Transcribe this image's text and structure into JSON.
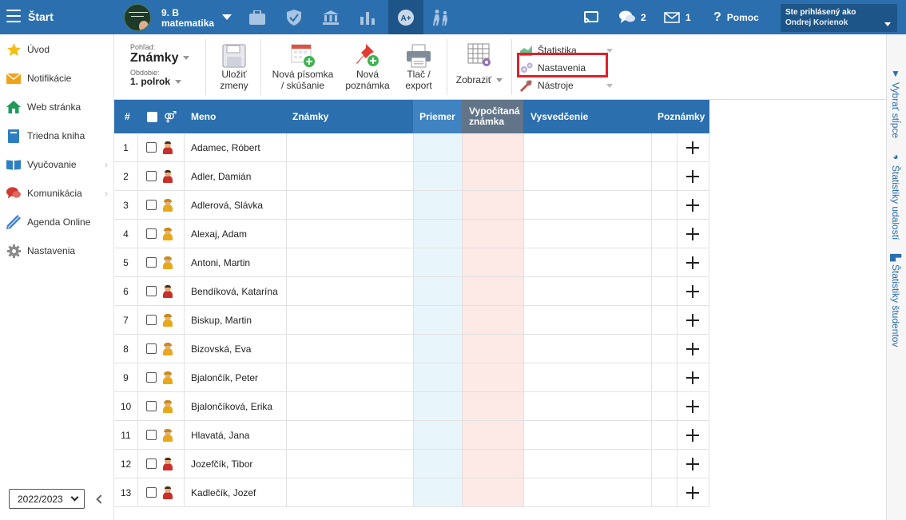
{
  "header": {
    "menu_label": "Štart",
    "class": {
      "line1": "9. B",
      "line2": "matematika"
    },
    "messages_count": "2",
    "mail_count": "1",
    "help_label": "Pomoc",
    "user": {
      "label": "Ste prihlásený ako",
      "name": "Ondrej Korienok"
    }
  },
  "sidebar": {
    "items": [
      {
        "label": "Úvod",
        "icon": "star-icon"
      },
      {
        "label": "Notifikácie",
        "icon": "envelope-icon"
      },
      {
        "label": "Web stránka",
        "icon": "home-icon"
      },
      {
        "label": "Triedna kniha",
        "icon": "book-icon"
      },
      {
        "label": "Vyučovanie",
        "icon": "open-book-icon"
      },
      {
        "label": "Komunikácia",
        "icon": "chat-icon"
      },
      {
        "label": "Agenda Online",
        "icon": "pen-icon"
      },
      {
        "label": "Nastavenia",
        "icon": "gear-icon"
      }
    ],
    "school_year": "2022/2023"
  },
  "toolbar": {
    "view_label": "Pohľad:",
    "view_value": "Známky",
    "period_label": "Obdobie:",
    "period_value": "1. polrok",
    "save_line1": "Uložiť",
    "save_line2": "zmeny",
    "new_test_line1": "Nová písomka",
    "new_test_line2": "/ skúšanie",
    "new_note_line1": "Nová",
    "new_note_line2": "poznámka",
    "print_line1": "Tlač /",
    "print_line2": "export",
    "show_label": "Zobraziť",
    "menu_statistics": "Štatistika",
    "menu_settings": "Nastavenia",
    "menu_tools": "Nástroje"
  },
  "right_tabs": {
    "columns": "Vybrať stĺpce",
    "event_stats": "Štatistiky udalostí",
    "student_stats": "Štatistiky študentov"
  },
  "table": {
    "headers": {
      "num": "#",
      "gender_symbol": "⚤",
      "name": "Meno",
      "grades": "Známky",
      "average": "Priemer",
      "computed_line1": "Vypočítaná",
      "computed_line2": "známka",
      "report": "Vysvedčenie",
      "notes": "Poznámky"
    },
    "rows": [
      {
        "num": "1",
        "name": "Adamec, Róbert",
        "gender": "m"
      },
      {
        "num": "2",
        "name": "Adler, Damián",
        "gender": "m"
      },
      {
        "num": "3",
        "name": "Adlerová, Slávka",
        "gender": "f"
      },
      {
        "num": "4",
        "name": "Alexaj, Adam",
        "gender": "f"
      },
      {
        "num": "5",
        "name": "Antoni, Martin",
        "gender": "f"
      },
      {
        "num": "6",
        "name": "Bendíková, Katarína",
        "gender": "m"
      },
      {
        "num": "7",
        "name": "Biskup, Martin",
        "gender": "f"
      },
      {
        "num": "8",
        "name": "Bizovská, Eva",
        "gender": "f"
      },
      {
        "num": "9",
        "name": "Bjalončík, Peter",
        "gender": "f"
      },
      {
        "num": "10",
        "name": "Bjalončíková, Erika",
        "gender": "f"
      },
      {
        "num": "11",
        "name": "Hlavatá, Jana",
        "gender": "f"
      },
      {
        "num": "12",
        "name": "Jozefčík, Tibor",
        "gender": "m"
      },
      {
        "num": "13",
        "name": "Kadlečík, Jozef",
        "gender": "m"
      }
    ]
  }
}
